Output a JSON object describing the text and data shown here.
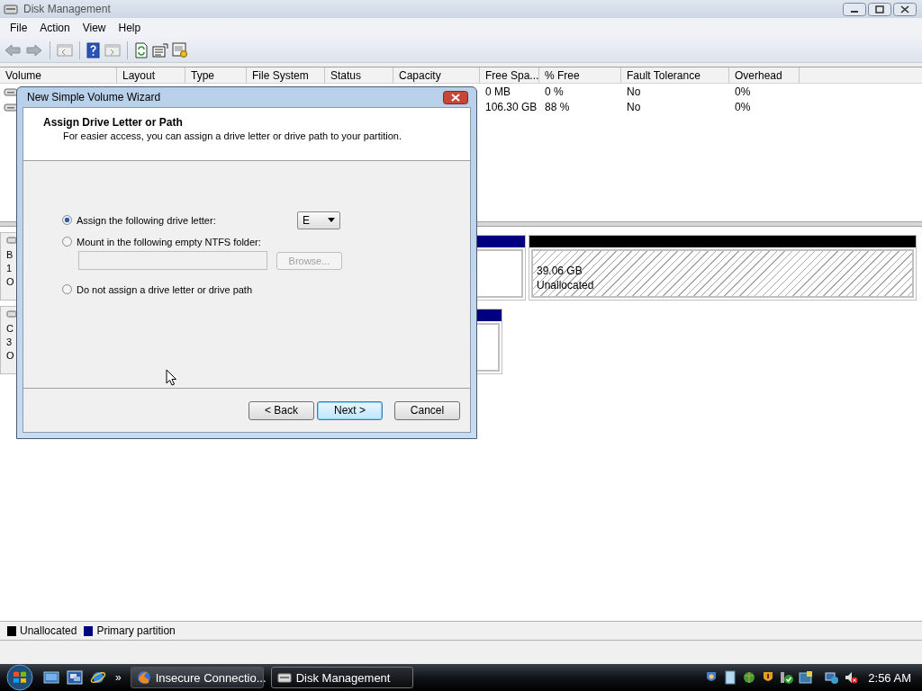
{
  "window": {
    "title": "Disk Management"
  },
  "menu": [
    "File",
    "Action",
    "View",
    "Help"
  ],
  "volume_table": {
    "columns": [
      "Volume",
      "Layout",
      "Type",
      "File System",
      "Status",
      "Capacity",
      "Free Spa...",
      "% Free",
      "Fault Tolerance",
      "Overhead"
    ],
    "rows": [
      {
        "free_space": "0 MB",
        "percent_free": "0 %",
        "fault_tolerance": "No",
        "overhead": "0%"
      },
      {
        "free_space": "106.30 GB",
        "percent_free": "88 %",
        "fault_tolerance": "No",
        "overhead": "0%"
      }
    ]
  },
  "disks": [
    {
      "label_lines": [
        "B",
        "1",
        "O"
      ],
      "partitions": [
        {
          "kind": "primary"
        },
        {
          "kind": "unallocated",
          "size": "39.06 GB",
          "status": "Unallocated"
        }
      ]
    },
    {
      "label_lines": [
        "C",
        "3",
        "O"
      ],
      "partitions": [
        {
          "kind": "primary"
        }
      ]
    }
  ],
  "legend": [
    {
      "label": "Unallocated",
      "color": "#000000"
    },
    {
      "label": "Primary partition",
      "color": "#000080"
    }
  ],
  "dialog": {
    "title": "New Simple Volume Wizard",
    "heading": "Assign Drive Letter or Path",
    "subtitle": "For easier access, you can assign a drive letter or drive path to your partition.",
    "options": [
      {
        "kind": "letter",
        "label": "Assign the following drive letter:",
        "selected": true,
        "value": "E"
      },
      {
        "kind": "folder",
        "label": "Mount in the following empty NTFS folder:",
        "selected": false,
        "button": "Browse...",
        "disabled": true
      },
      {
        "kind": "none",
        "label": "Do not assign a drive letter or drive path",
        "selected": false
      }
    ],
    "buttons": [
      {
        "label": "< Back",
        "default": false
      },
      {
        "label": "Next >",
        "default": true
      },
      {
        "label": "Cancel",
        "default": false
      }
    ]
  },
  "taskbar": {
    "more": "»",
    "tasks": [
      {
        "label": "Insecure Connectio...",
        "selected": false
      },
      {
        "label": "Disk Management",
        "selected": true
      }
    ],
    "clock": "2:56 AM"
  }
}
